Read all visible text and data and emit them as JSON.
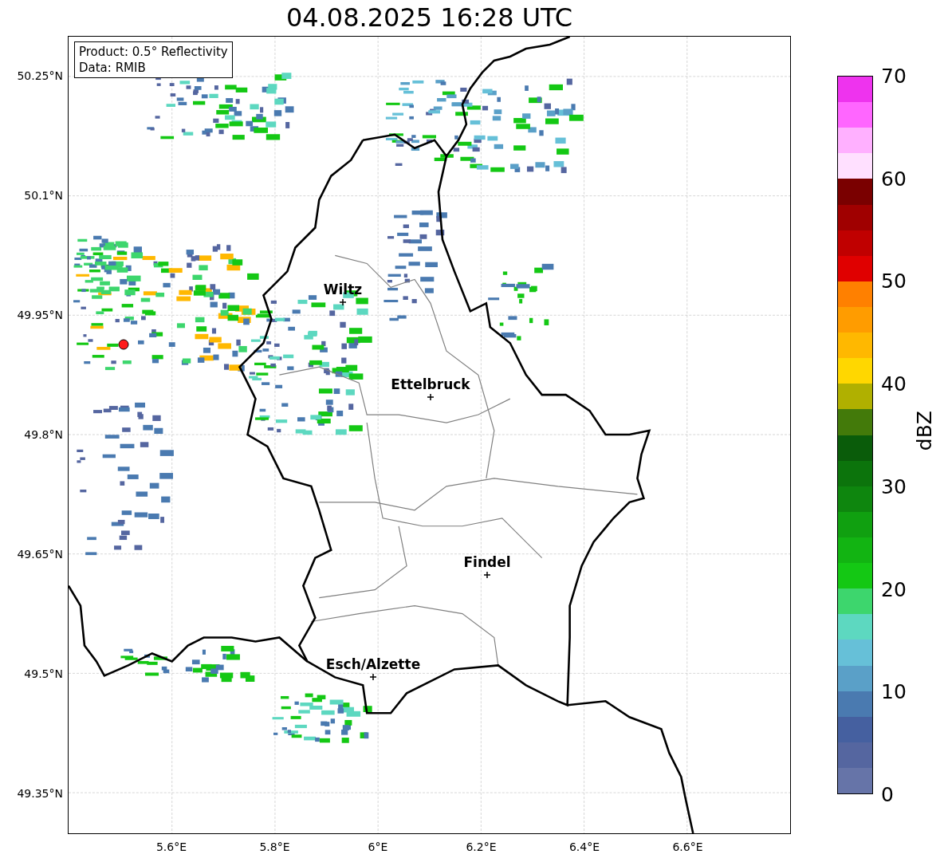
{
  "title": "04.08.2025 16:28 UTC",
  "info_box": {
    "product": "Product: 0.5° Reflectivity",
    "source": "Data: RMIB"
  },
  "lat_ticks": [
    "50.25°N",
    "50.1°N",
    "49.95°N",
    "49.8°N",
    "49.65°N",
    "49.5°N",
    "49.35°N"
  ],
  "lon_ticks": [
    "5.6°E",
    "5.8°E",
    "6°E",
    "6.2°E",
    "6.4°E",
    "6.6°E"
  ],
  "cities": [
    {
      "name": "Wiltz"
    },
    {
      "name": "Ettelbruck"
    },
    {
      "name": "Findel"
    },
    {
      "name": "Esch/Alzette"
    }
  ],
  "colorbar": {
    "label": "dBZ",
    "ticks": [
      "70",
      "60",
      "50",
      "40",
      "30",
      "20",
      "10",
      "0"
    ],
    "segments": [
      {
        "color": "#ee33ee"
      },
      {
        "color": "#ff66ff"
      },
      {
        "color": "#ffb0ff"
      },
      {
        "color": "#ffe0ff"
      },
      {
        "color": "#7a0000"
      },
      {
        "color": "#a00000"
      },
      {
        "color": "#c00000"
      },
      {
        "color": "#e00000"
      },
      {
        "color": "#ff8000"
      },
      {
        "color": "#ff9c00"
      },
      {
        "color": "#ffb800"
      },
      {
        "color": "#ffd700"
      },
      {
        "color": "#b0b000"
      },
      {
        "color": "#437a0a"
      },
      {
        "color": "#0a5c0a"
      },
      {
        "color": "#0c740c"
      },
      {
        "color": "#0e860e"
      },
      {
        "color": "#10a010"
      },
      {
        "color": "#12b412"
      },
      {
        "color": "#14c814"
      },
      {
        "color": "#3dd66d"
      },
      {
        "color": "#5dd8c0"
      },
      {
        "color": "#66c0d8"
      },
      {
        "color": "#5aa0c8"
      },
      {
        "color": "#4a7ab0"
      },
      {
        "color": "#4560a0"
      },
      {
        "color": "#5566a0"
      },
      {
        "color": "#6674a8"
      }
    ]
  }
}
